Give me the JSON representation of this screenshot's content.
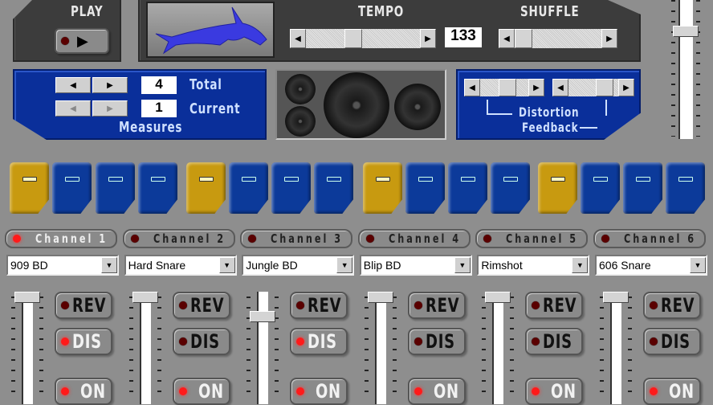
{
  "play": {
    "label": "PLAY"
  },
  "tempo": {
    "label": "TEMPO",
    "value": "133",
    "position": 0.4
  },
  "shuffle": {
    "label": "SHUFFLE",
    "position": 0.0
  },
  "master_volume": {
    "position": 0.2
  },
  "measures": {
    "title": "Measures",
    "total_label": "Total",
    "total": "4",
    "current_label": "Current",
    "current": "1"
  },
  "effects": {
    "distortion_label": "Distortion",
    "feedback_label": "Feedback",
    "distortion_position": 0.6,
    "feedback_position": 0.85
  },
  "steps": [
    true,
    false,
    false,
    false,
    true,
    false,
    false,
    false,
    true,
    false,
    false,
    false,
    true,
    false,
    false,
    false
  ],
  "channels": [
    {
      "label": "Channel 1",
      "selected": true,
      "sample": "909 BD",
      "volume": 1.0,
      "rev": false,
      "dis": true,
      "on": true
    },
    {
      "label": "Channel 2",
      "selected": false,
      "sample": "Hard Snare",
      "volume": 1.0,
      "rev": false,
      "dis": false,
      "on": true
    },
    {
      "label": "Channel 3",
      "selected": false,
      "sample": "Jungle BD",
      "volume": 0.8,
      "rev": false,
      "dis": true,
      "on": true
    },
    {
      "label": "Channel 4",
      "selected": false,
      "sample": "Blip BD",
      "volume": 1.0,
      "rev": false,
      "dis": false,
      "on": true
    },
    {
      "label": "Channel 5",
      "selected": false,
      "sample": "Rimshot",
      "volume": 1.0,
      "rev": false,
      "dis": false,
      "on": true
    },
    {
      "label": "Channel 6",
      "selected": false,
      "sample": "606 Snare",
      "volume": 1.0,
      "rev": false,
      "dis": false,
      "on": true
    }
  ],
  "fx_labels": {
    "rev": "REV",
    "dis": "DIS",
    "on": "ON"
  }
}
